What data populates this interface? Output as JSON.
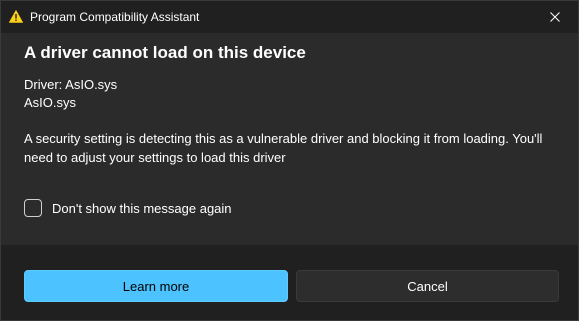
{
  "window": {
    "title": "Program Compatibility Assistant",
    "title_icon": "warning-icon",
    "close_icon": "close-icon"
  },
  "dialog": {
    "heading": "A driver cannot load on this device",
    "driver_label": "Driver: AsIO.sys",
    "driver_name": "AsIO.sys",
    "description": "A security setting is detecting this as a vulnerable driver and blocking it from loading. You'll need to adjust your settings to load this driver",
    "checkbox_label": "Don't show this message again",
    "checkbox_checked": false
  },
  "footer": {
    "primary_button": "Learn more",
    "secondary_button": "Cancel"
  },
  "colors": {
    "accent": "#4cc2ff",
    "warning": "#fcd116",
    "background": "#2b2b2b",
    "titlebar": "#202020"
  }
}
